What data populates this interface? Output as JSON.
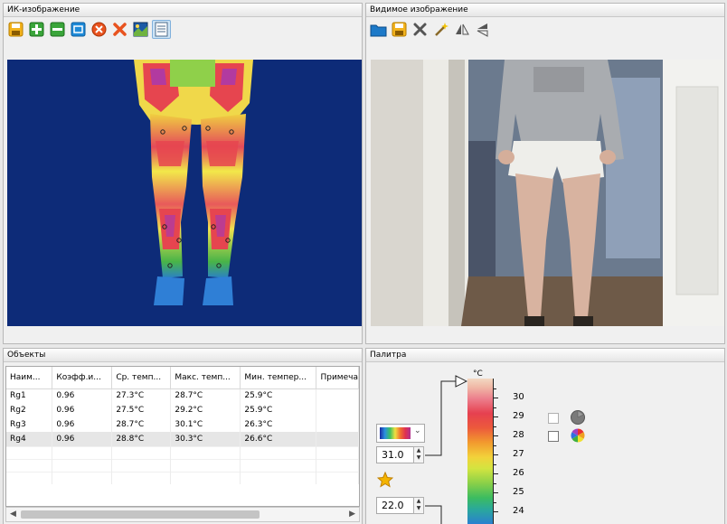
{
  "ir_panel": {
    "title": "ИК-изображение"
  },
  "visible_panel": {
    "title": "Видимое изображение"
  },
  "objects_panel": {
    "title": "Объекты",
    "columns": [
      "Наим...",
      "Коэфф.и...",
      "Ср. темп...",
      "Макс. темп...",
      "Мин. темпер...",
      "Примеча"
    ],
    "rows": [
      {
        "name": "Rg1",
        "coeff": "0.96",
        "avg": "27.3°C",
        "max": "28.7°C",
        "min": "25.9°C",
        "note": ""
      },
      {
        "name": "Rg2",
        "coeff": "0.96",
        "avg": "27.5°C",
        "max": "29.2°C",
        "min": "25.9°C",
        "note": ""
      },
      {
        "name": "Rg3",
        "coeff": "0.96",
        "avg": "28.7°C",
        "max": "30.1°C",
        "min": "26.3°C",
        "note": ""
      },
      {
        "name": "Rg4",
        "coeff": "0.96",
        "avg": "28.8°C",
        "max": "30.3°C",
        "min": "26.6°C",
        "note": ""
      }
    ]
  },
  "palette_panel": {
    "title": "Палитра",
    "unit": "°C",
    "max_value": "31.0",
    "min_value": "22.0",
    "scale_ticks": [
      "30",
      "29",
      "28",
      "27",
      "26",
      "25",
      "24"
    ]
  },
  "colors": {
    "ir_background": "#0d2b78",
    "selection": "#e6e6e6"
  }
}
